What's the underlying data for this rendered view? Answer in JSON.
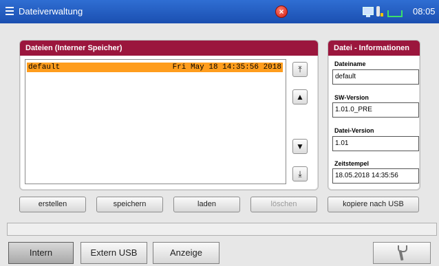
{
  "window": {
    "title": "Dateiverwaltung",
    "time": "08:05"
  },
  "files_panel": {
    "header": "Dateien (Interner Speicher)",
    "files": [
      {
        "name": "default",
        "date": "Fri May 18 14:35:56 2018",
        "selected": true
      }
    ]
  },
  "navigation": {
    "first": "⤒",
    "up": "▲",
    "down": "▼",
    "last": "⤓"
  },
  "info_panel": {
    "header": "Datei - Informationen",
    "fields": [
      {
        "label": "Dateiname",
        "value": "default"
      },
      {
        "label": "SW-Version",
        "value": "1.01.0_PRE"
      },
      {
        "label": "Datei-Version",
        "value": "1.01"
      },
      {
        "label": "Zeitstempel",
        "value": "18.05.2018  14:35:56"
      }
    ]
  },
  "actions": {
    "create": "erstellen",
    "save": "speichern",
    "load": "laden",
    "delete": "löschen",
    "copy_usb": "kopiere nach USB"
  },
  "tabs": {
    "internal": "Intern",
    "external_usb": "Extern USB",
    "display": "Anzeige"
  },
  "icons": {
    "menu": "hamburger-menu-icon",
    "error": "error-icon",
    "monitor": "monitor-icon",
    "bottle": "bottle-icon",
    "usb": "usb-plug-icon",
    "tool": "wrench-icon"
  },
  "colors": {
    "title_bar": "#1b4fb0",
    "panel_header": "#9b163d",
    "selection": "#ff9d1d",
    "error": "#d01c10"
  }
}
